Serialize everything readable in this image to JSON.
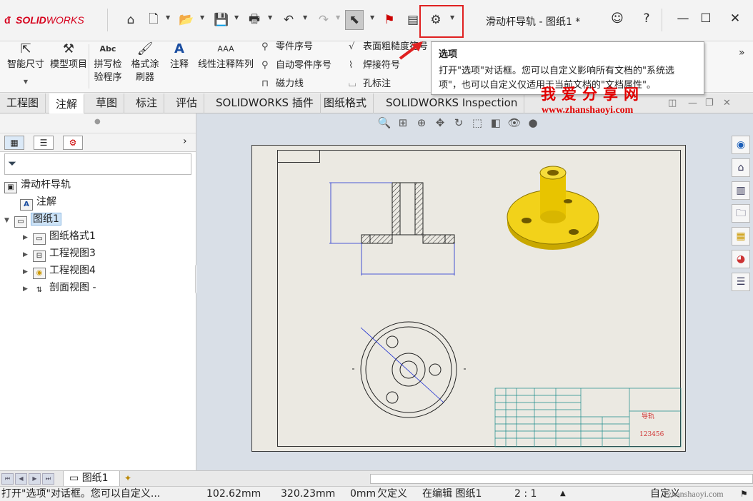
{
  "app": {
    "logo_prefix": "SOLID",
    "logo_suffix": "WORKS",
    "document_title": "滑动杆导轨 - 图纸1 *"
  },
  "quick_access": {
    "icons": [
      "home-icon",
      "new-document-icon",
      "open-icon",
      "save-icon",
      "print-icon",
      "undo-icon",
      "redo-icon",
      "select-icon",
      "rebuild-icon",
      "file-properties-icon",
      "options-gear-icon"
    ]
  },
  "ribbon": {
    "smart_dimension": "智能尺寸",
    "model_items": "模型项目",
    "spell_checker_line1": "拼写检",
    "spell_checker_line2": "验程序",
    "format_painter_line1": "格式涂",
    "format_painter_line2": "刷器",
    "note": "注释",
    "linear_note_pattern": "线性注释阵列",
    "balloon": "零件序号",
    "auto_balloon": "自动零件序号",
    "magnetic_line": "磁力线",
    "surface_finish": "表面粗糙度符号",
    "weld_symbol": "焊接符号",
    "hole_callout": "孔标注",
    "spell_abc": "Abc"
  },
  "tooltip": {
    "title": "选项",
    "body": "打开\"选项\"对话框。您可以自定义影响所有文档的\"系统选项\"，也可以自定义仅适用于当前文档的\"文档属性\"。"
  },
  "watermark": {
    "cn": "我爱分享网",
    "url": "www.zhanshaoyi.com",
    "status_url": "zhanshaoyi.com"
  },
  "tabs": [
    "工程图",
    "注解",
    "草图",
    "标注",
    "评估",
    "SOLIDWORKS 插件",
    "图纸格式",
    "SOLIDWORKS Inspection"
  ],
  "active_tab": "注解",
  "feature_tree": {
    "root": "滑动杆导轨",
    "annotations": "注解",
    "sheet": "图纸1",
    "sheet_format": "图纸格式1",
    "drawing_view3": "工程视图3",
    "drawing_view4": "工程视图4",
    "section_view": "剖面视图 -"
  },
  "drawing": {
    "title_block_name": "导轨",
    "title_block_number": "123456"
  },
  "bottom": {
    "sheet_tab": "图纸1"
  },
  "status": {
    "message": "打开\"选项\"对话框。您可以自定义...",
    "x": "102.62mm",
    "y": "320.23mm",
    "z": "0mm",
    "defined": "欠定义",
    "editing": "在编辑 图纸1",
    "scale": "2 : 1",
    "units": "自定义"
  },
  "colors": {
    "brand_red": "#d6001c",
    "highlight_red": "#e02020",
    "dimension_blue": "#1a2bd0",
    "title_block_teal": "#1b8a8a",
    "part_yellow": "#f2d21a"
  }
}
